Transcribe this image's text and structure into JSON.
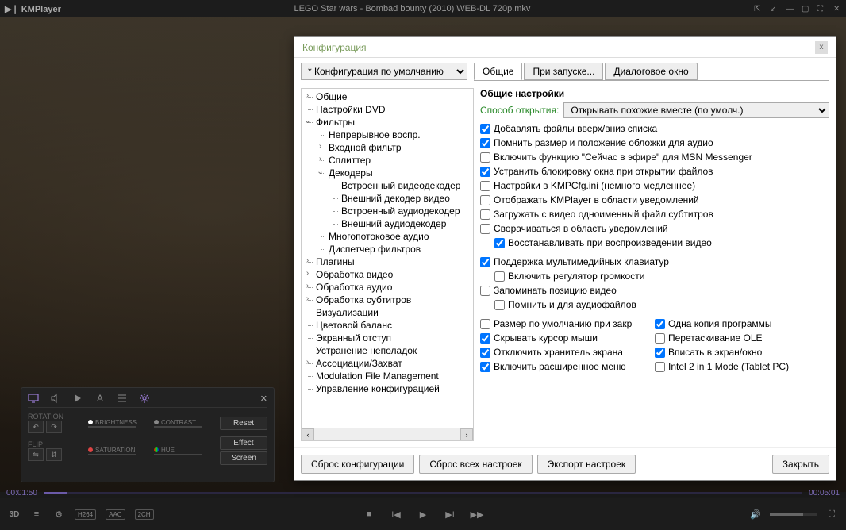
{
  "titlebar": {
    "app": "KMPlayer",
    "title": "LEGO Star wars - Bombad bounty (2010) WEB-DL 720p.mkv"
  },
  "eq": {
    "rotation": "ROTATION",
    "flip": "FLIP",
    "brightness": "BRIGHTNESS",
    "contrast": "CONTRAST",
    "saturation": "SATURATION",
    "hue": "HUE",
    "reset": "Reset",
    "effect": "Effect",
    "screen": "Screen"
  },
  "dialog": {
    "title": "Конфигурация",
    "config_select": "* Конфигурация по умолчанию",
    "tabs": [
      "Общие",
      "При запуске...",
      "Диалоговое окно"
    ],
    "tree": {
      "l0": "Общие",
      "l1": "Настройки DVD",
      "l2": "Фильтры",
      "l2_0": "Непрерывное воспр.",
      "l2_1": "Входной фильтр",
      "l2_2": "Сплиттер",
      "l2_3": "Декодеры",
      "l2_3_0": "Встроенный видеодекодер",
      "l2_3_1": "Внешний декодер видео",
      "l2_3_2": "Встроенный аудиодекодер",
      "l2_3_3": "Внешний аудиодекодер",
      "l2_4": "Многопотоковое аудио",
      "l2_5": "Диспетчер фильтров",
      "l3": "Плагины",
      "l4": "Обработка видео",
      "l5": "Обработка аудио",
      "l6": "Обработка субтитров",
      "l7": "Визуализации",
      "l8": "Цветовой баланс",
      "l9": "Экранный отступ",
      "l10": "Устранение неполадок",
      "l11": "Ассоциации/Захват",
      "l12": "Modulation File Management",
      "l13": "Управление конфигурацией"
    },
    "settings": {
      "heading": "Общие настройки",
      "open_label": "Способ открытия:",
      "open_value": "Открывать похожие вместе (по умолч.)",
      "c1": "Добавлять файлы вверх/вниз списка",
      "c2": "Помнить размер и положение обложки для аудио",
      "c3": "Включить функцию \"Сейчас в эфире\" для MSN Messenger",
      "c4": "Устранить блокировку окна при открытии файлов",
      "c5": "Настройки в KMPCfg.ini (немного медленнее)",
      "c6": "Отображать KMPlayer в области уведомлений",
      "c7": "Загружать с видео одноименный файл субтитров",
      "c8": "Сворачиваться в область уведомлений",
      "c8a": "Восстанавливать при воспроизведении видео",
      "c9": "Поддержка мультимедийных клавиатур",
      "c9a": "Включить регулятор громкости",
      "c10": "Запоминать позицию видео",
      "c10a": "Помнить и для аудиофайлов",
      "c11": "Размер по умолчанию при закр",
      "c12": "Одна копия программы",
      "c13": "Скрывать курсор мыши",
      "c14": "Перетаскивание OLE",
      "c15": "Отключить хранитель экрана",
      "c16": "Вписать в экран/окно",
      "c17": "Включить расширенное меню",
      "c18": "Intel 2 in 1 Mode (Tablet PC)"
    },
    "footer": {
      "reset_cfg": "Сброс конфигурации",
      "reset_all": "Сброс всех настроек",
      "export": "Экспорт настроек",
      "close": "Закрыть"
    }
  },
  "seek": {
    "left": "00:01:50",
    "right": "00:05:01"
  },
  "bottom": {
    "badges": [
      "H264",
      "AAC",
      "2CH"
    ]
  }
}
